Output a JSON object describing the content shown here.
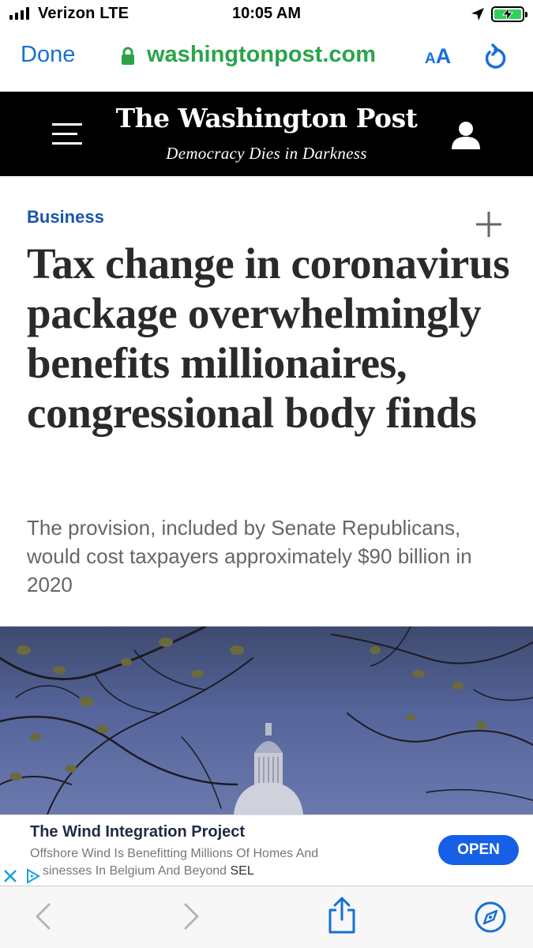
{
  "status_bar": {
    "carrier": "Verizon LTE",
    "time": "10:05 AM",
    "battery_color": "#30d158",
    "icons": [
      "signal-bars-icon",
      "location-arrow-icon",
      "battery-charging-icon"
    ]
  },
  "browser": {
    "done_label": "Done",
    "url": "washingtonpost.com",
    "text_size_small": "A",
    "text_size_big": "A",
    "accent_color": "#1670d6",
    "url_color": "#2aa44a",
    "icons": [
      "lock-icon",
      "reload-icon"
    ]
  },
  "masthead": {
    "title": "The Washington Post",
    "tagline": "Democracy Dies in Darkness",
    "icons": [
      "menu-icon",
      "user-icon"
    ]
  },
  "article": {
    "section": "Business",
    "section_color": "#1955a5",
    "headline": "Tax change in coronavirus package overwhelmingly benefits millionaires, congressional body finds",
    "dek": "The provision, included by Senate Republicans, would cost taxpayers approximately $90 billion in 2020",
    "icons": [
      "plus-icon"
    ]
  },
  "ad": {
    "title": "The Wind Integration Project",
    "body_line1": "Offshore Wind Is Benefitting Millions Of Homes And",
    "body_line2": "sinesses In Belgium And Beyond",
    "sponsor": "SEL",
    "cta": "OPEN",
    "cta_color": "#1660e8",
    "icons": [
      "close-icon",
      "adchoices-icon"
    ]
  },
  "toolbar": {
    "icons": [
      "back-icon",
      "forward-icon",
      "share-icon",
      "safari-compass-icon"
    ]
  }
}
